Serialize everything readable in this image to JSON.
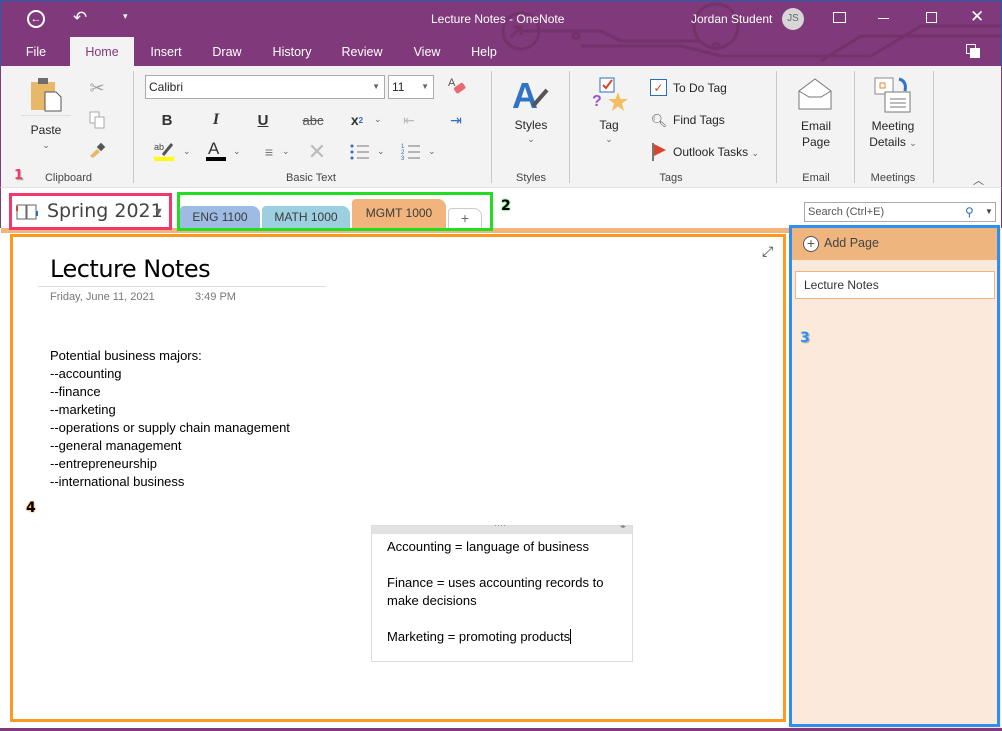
{
  "window": {
    "title": "Lecture Notes  -  OneNote",
    "user_name": "Jordan Student",
    "user_initials": "JS"
  },
  "quick_access": {
    "back": "back-icon",
    "undo": "undo-icon",
    "customize": "customize-qat-icon"
  },
  "menu_tabs": [
    {
      "label": "File"
    },
    {
      "label": "Home",
      "active": true
    },
    {
      "label": "Insert"
    },
    {
      "label": "Draw"
    },
    {
      "label": "History"
    },
    {
      "label": "Review"
    },
    {
      "label": "View"
    },
    {
      "label": "Help"
    }
  ],
  "ribbon": {
    "clipboard": {
      "paste": "Paste",
      "label": "Clipboard"
    },
    "basic_text": {
      "font": "Calibri",
      "size": "11",
      "label": "Basic Text"
    },
    "styles": {
      "button": "Styles",
      "label": "Styles"
    },
    "tags": {
      "tag": "Tag",
      "todo": "To Do Tag",
      "find": "Find Tags",
      "outlook": "Outlook Tasks",
      "label": "Tags"
    },
    "email": {
      "line1": "Email",
      "line2": "Page",
      "label": "Email"
    },
    "meetings": {
      "line1": "Meeting",
      "line2": "Details",
      "label": "Meetings"
    },
    "colors": {
      "highlight": "#ffff00",
      "font_color": "#000000"
    }
  },
  "notebook": {
    "name": "Spring 2021"
  },
  "sections": [
    {
      "label": "ENG 1100",
      "color": "#9dbbe3"
    },
    {
      "label": "MATH 1000",
      "color": "#9ccfe0"
    },
    {
      "label": "MGMT 1000",
      "color": "#f0b47c",
      "active": true
    }
  ],
  "add_section": "+",
  "search": {
    "placeholder": "Search (Ctrl+E)"
  },
  "page": {
    "title": "Lecture Notes",
    "date": "Friday, June 11, 2021",
    "time": "3:49 PM",
    "note1": [
      "Potential business majors:",
      "--accounting",
      "--finance",
      "--marketing",
      "--operations or supply chain management",
      "--general management",
      "--entrepreneurship",
      "--international business"
    ],
    "note2": [
      "Accounting = language of business",
      "",
      "Finance = uses accounting records to",
      "make decisions",
      "",
      "Marketing = promoting products"
    ]
  },
  "sidebar": {
    "add_page": "Add Page",
    "pages": [
      {
        "label": "Lecture Notes"
      }
    ]
  },
  "annotations": {
    "badge1": "1",
    "badge2": "2",
    "badge3": "3",
    "badge4": "4",
    "color1": "#f0386b",
    "color2": "#22dd22",
    "color3": "#2f8ff0",
    "color4": "#ff9a20"
  }
}
